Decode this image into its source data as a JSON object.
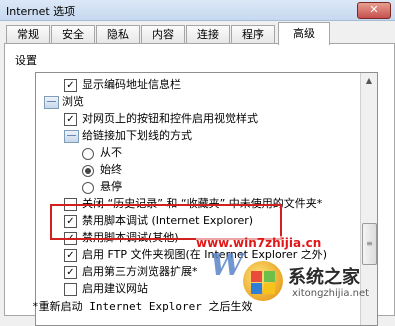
{
  "window": {
    "title": "Internet 选项",
    "close_label": "✕"
  },
  "tabs": [
    {
      "label": "常规"
    },
    {
      "label": "安全"
    },
    {
      "label": "隐私"
    },
    {
      "label": "内容"
    },
    {
      "label": "连接"
    },
    {
      "label": "程序"
    },
    {
      "label": "高级",
      "active": true
    }
  ],
  "settings": {
    "section_label": "设置",
    "items": [
      {
        "type": "checkbox",
        "checked": true,
        "label": "显示编码地址信息栏"
      },
      {
        "type": "group",
        "label": "浏览"
      },
      {
        "type": "checkbox",
        "checked": true,
        "label": "对网页上的按钮和控件启用视觉样式"
      },
      {
        "type": "group",
        "label": "给链接加下划线的方式"
      },
      {
        "type": "radio",
        "selected": false,
        "label": "从不"
      },
      {
        "type": "radio",
        "selected": true,
        "label": "始终"
      },
      {
        "type": "radio",
        "selected": false,
        "label": "悬停"
      },
      {
        "type": "checkbox",
        "checked": false,
        "label": "关闭 “历史记录” 和 “收藏夹” 中未使用的文件夹*"
      },
      {
        "type": "checkbox",
        "checked": true,
        "label": "禁用脚本调试 (Internet Explorer)"
      },
      {
        "type": "checkbox",
        "checked": true,
        "label": "禁用脚本调试(其他)"
      },
      {
        "type": "checkbox",
        "checked": true,
        "label": "启用 FTP 文件夹视图(在 Internet Explorer 之外)"
      },
      {
        "type": "checkbox",
        "checked": true,
        "label": "启用第三方浏览器扩展*"
      },
      {
        "type": "checkbox",
        "checked": false,
        "label": "启用建议网站"
      }
    ]
  },
  "footer_note": "*重新启动 Internet Explorer 之后生效",
  "watermark": {
    "url": "www.win7zhijia.cn",
    "brand": "系统之家",
    "domain": "xitongzhijia.net",
    "w7": "W"
  },
  "colors": {
    "highlight_border": "#d02020",
    "watermark_red": "#e21818"
  }
}
